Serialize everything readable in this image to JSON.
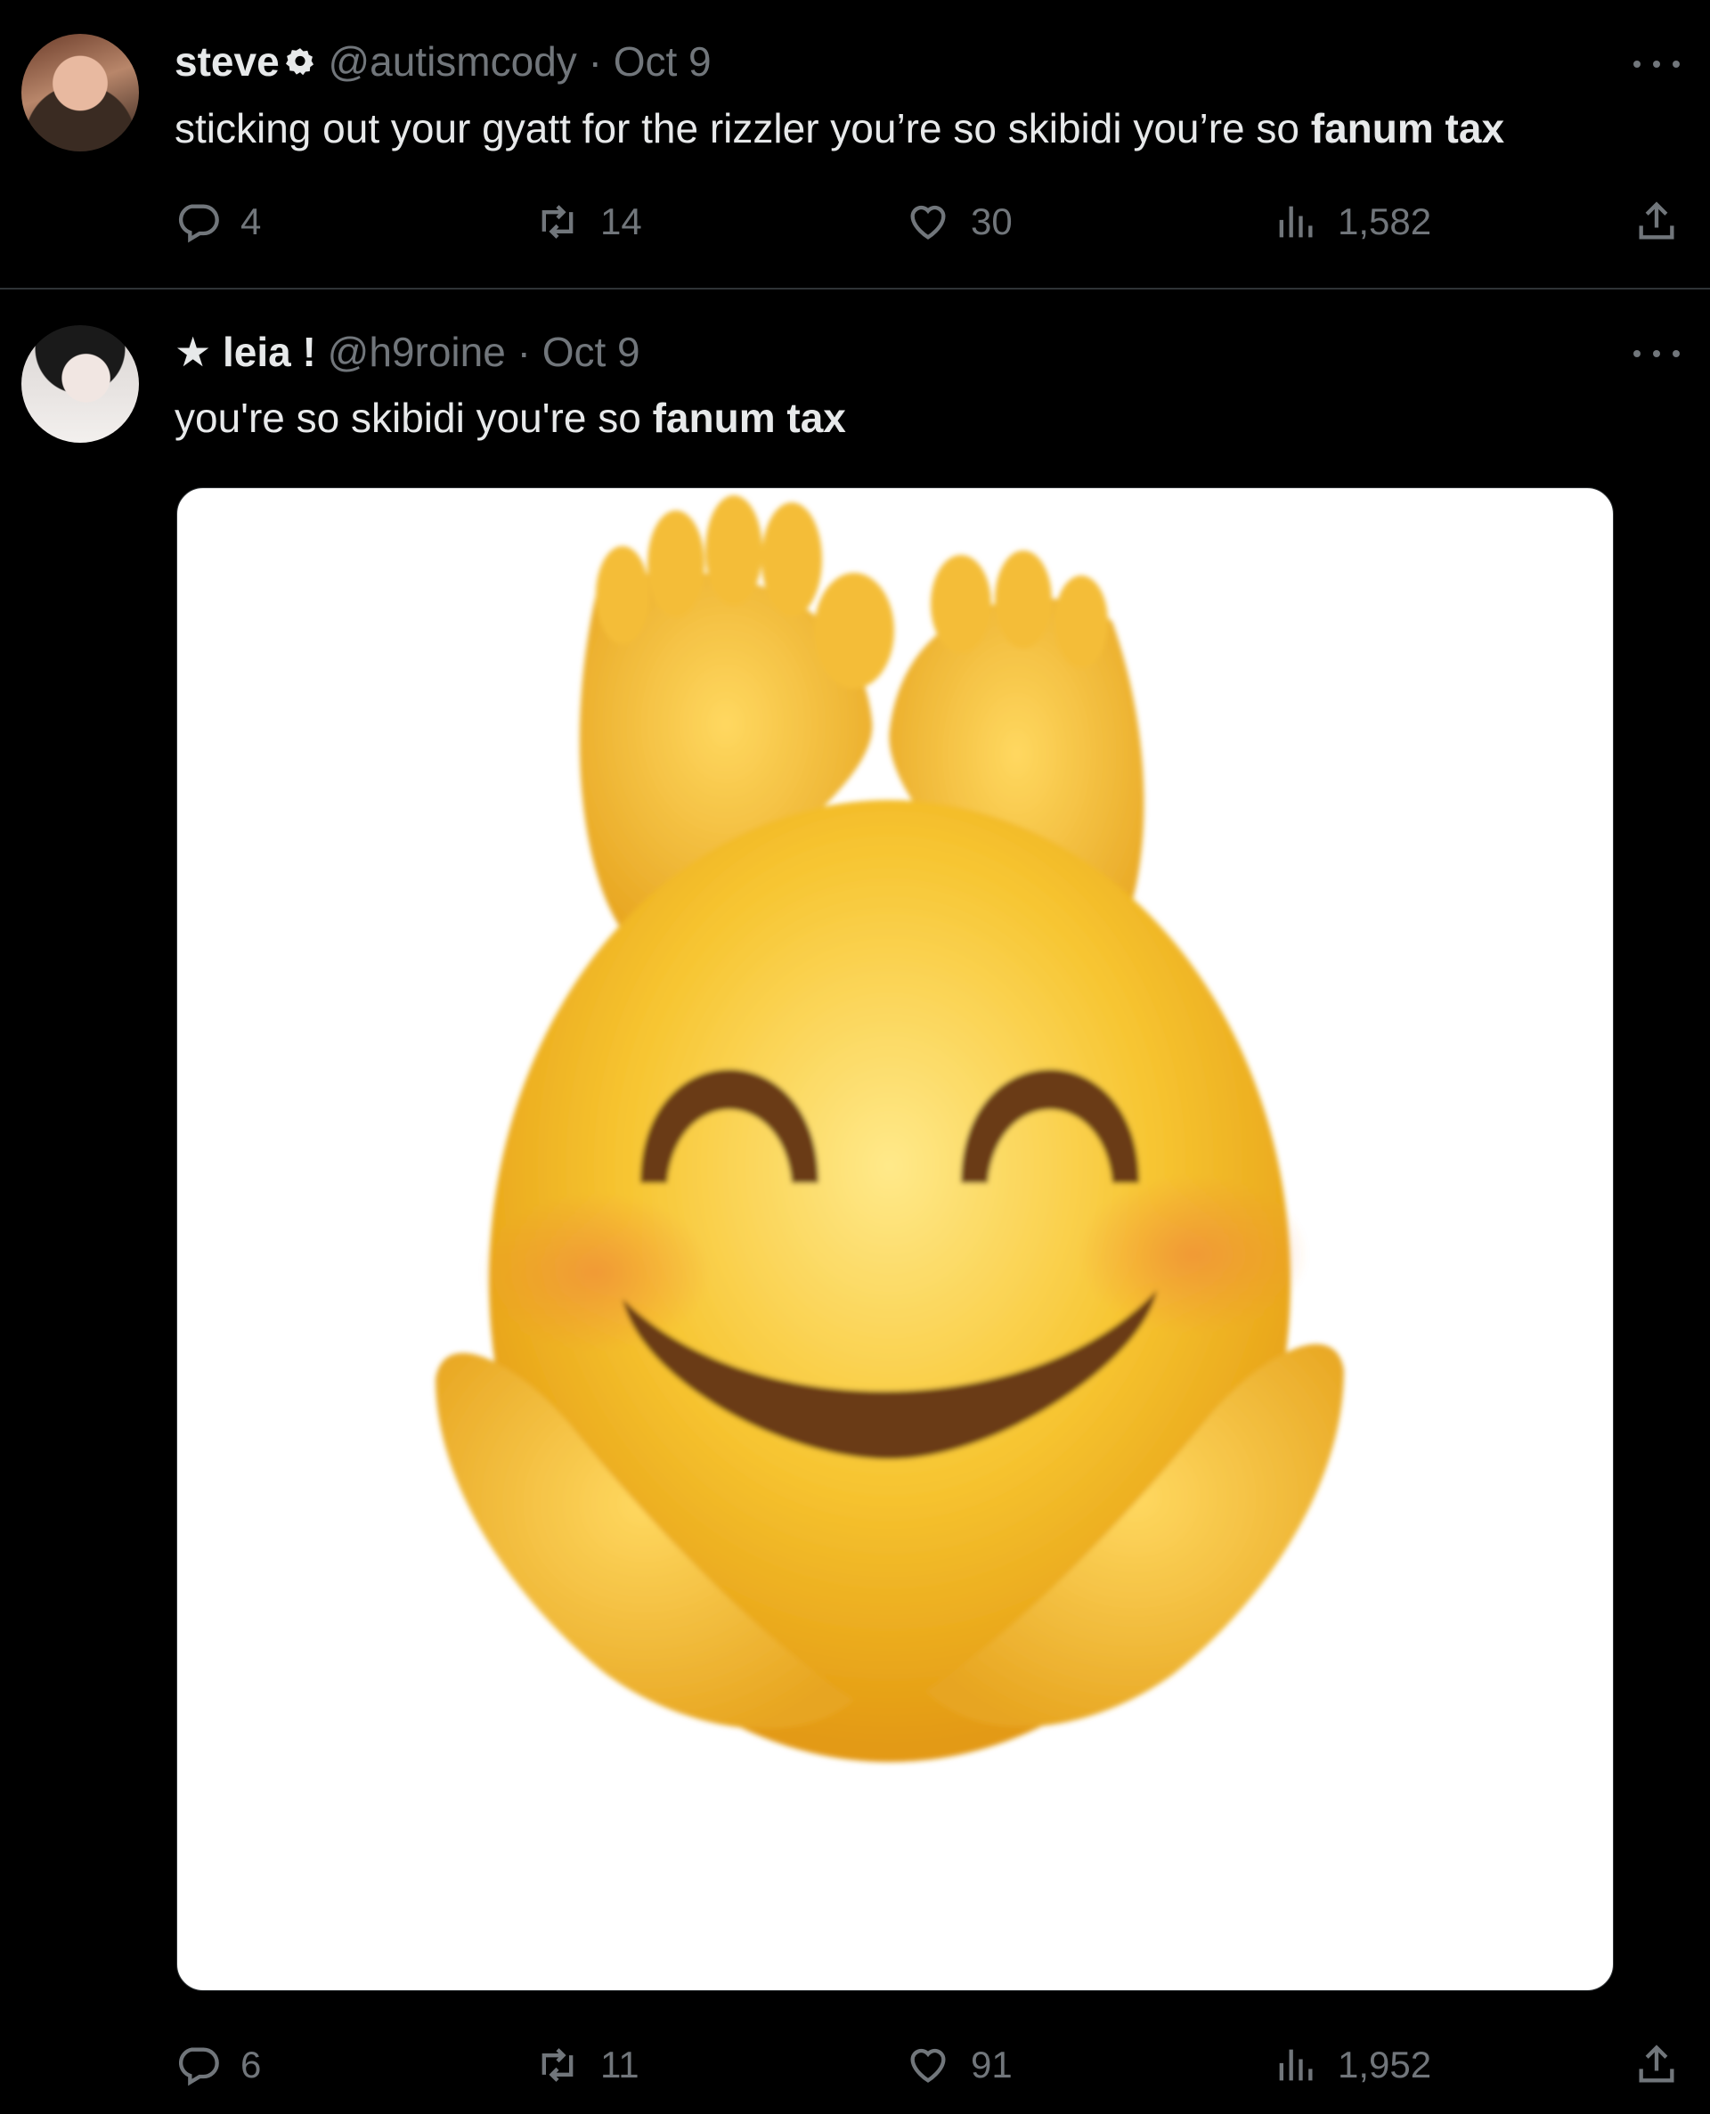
{
  "tweets": [
    {
      "name": "steve",
      "handle": "@autismcody",
      "separator": "·",
      "date": "Oct 9",
      "text_plain": "sticking out your gyatt for the rizzler you’re so skibidi you’re so ",
      "text_bold": "fanum tax",
      "replies": "4",
      "retweets": "14",
      "likes": "30",
      "views": "1,582"
    },
    {
      "name_prefix": "★",
      "name": "leia !",
      "handle": "@h9roine",
      "separator": "·",
      "date": "Oct 9",
      "text_plain": "you're so skibidi you're so ",
      "text_bold": "fanum tax",
      "media": "smiling-emoji-with-feet-image",
      "replies": "6",
      "retweets": "11",
      "likes": "91",
      "views": "1,952"
    }
  ],
  "icons": {
    "reply": "reply-icon",
    "retweet": "retweet-icon",
    "like": "heart-icon",
    "views": "views-icon",
    "share": "share-icon",
    "more": "more-icon",
    "badge": "verified-badge-icon"
  },
  "colors": {
    "background": "#000000",
    "text": "#e7e9ea",
    "muted": "#71767b",
    "divider": "#2f3336",
    "emoji_yellow": "#f5c229"
  }
}
